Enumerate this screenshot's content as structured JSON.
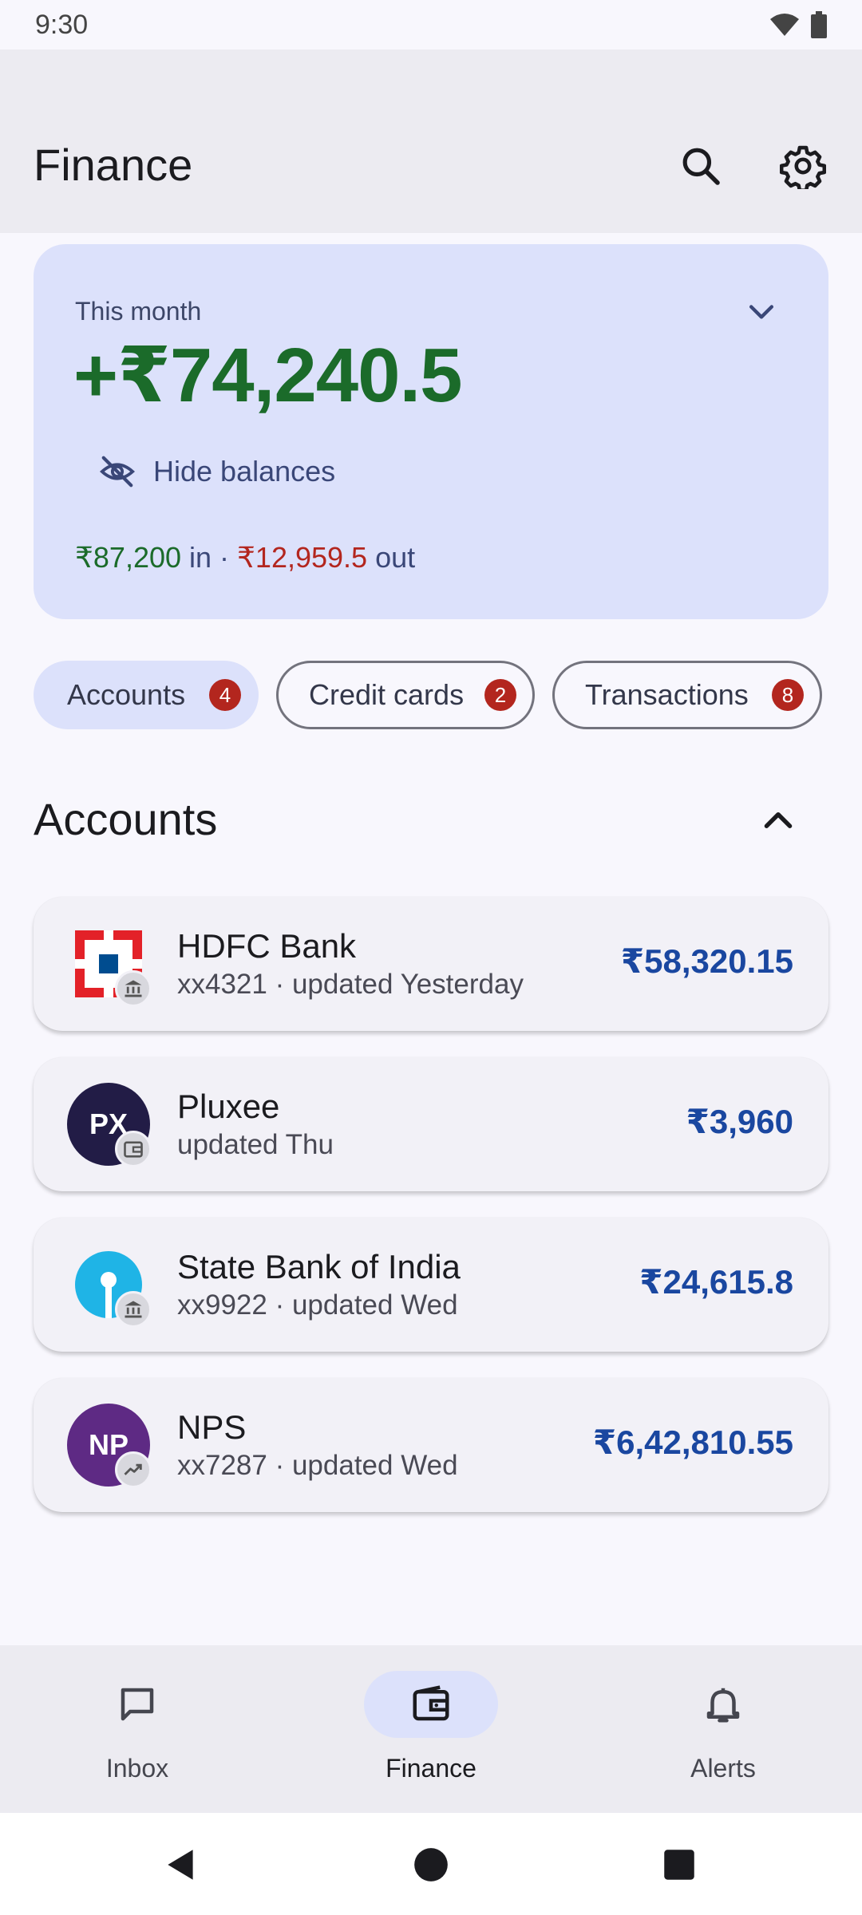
{
  "status_bar": {
    "time": "9:30"
  },
  "app_bar": {
    "title": "Finance",
    "search_icon": "search-icon",
    "settings_icon": "gear-icon"
  },
  "summary": {
    "label": "This month",
    "amount": "+₹74,240.5",
    "hide_balances": "Hide balances",
    "in_amount": "₹87,200",
    "in_label": " in · ",
    "out_amount": "₹12,959.5",
    "out_label": " out",
    "colors": {
      "positive": "#1b6b2a",
      "negative": "#b3261e",
      "card": "#dce1fb"
    }
  },
  "chips": [
    {
      "label": "Accounts",
      "count": "4",
      "selected": true
    },
    {
      "label": "Credit cards",
      "count": "2",
      "selected": false
    },
    {
      "label": "Transactions",
      "count": "8",
      "selected": false
    }
  ],
  "section": {
    "title": "Accounts"
  },
  "accounts": [
    {
      "name": "HDFC Bank",
      "meta": "xx4321 · updated Yesterday",
      "balance": "₹58,320.15",
      "logo_text": "",
      "type_icon": "bank-icon"
    },
    {
      "name": "Pluxee",
      "meta": "updated Thu",
      "balance": "₹3,960",
      "logo_text": "PX",
      "type_icon": "wallet-icon"
    },
    {
      "name": "State Bank of India",
      "meta": "xx9922 · updated Wed",
      "balance": "₹24,615.8",
      "logo_text": "",
      "type_icon": "bank-icon"
    },
    {
      "name": "NPS",
      "meta": "xx7287 · updated Wed",
      "balance": "₹6,42,810.55",
      "logo_text": "NP",
      "type_icon": "trending-up-icon"
    }
  ],
  "bottom_nav": [
    {
      "label": "Inbox",
      "icon": "chat-icon",
      "active": false
    },
    {
      "label": "Finance",
      "icon": "wallet-icon",
      "active": true
    },
    {
      "label": "Alerts",
      "icon": "bell-icon",
      "active": false
    }
  ]
}
